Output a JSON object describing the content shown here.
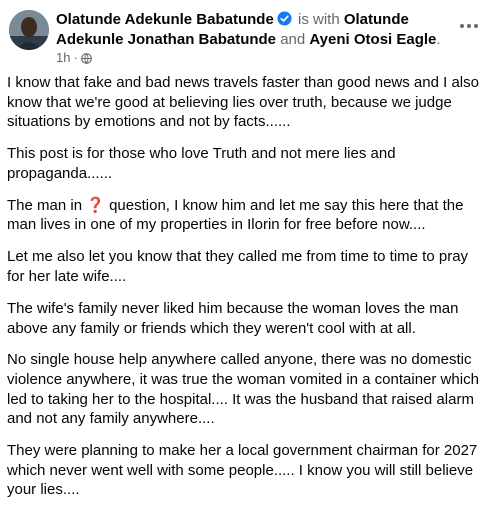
{
  "header": {
    "author": "Olatunde Adekunle Babatunde",
    "with_text": "is with",
    "tagged_1": "Olatunde Adekunle Jonathan Babatunde",
    "and_text": "and",
    "tagged_2": "Ayeni Otosi Eagle",
    "period": ".",
    "time": "1h",
    "dot": "·",
    "icons": {
      "verified": "verified-badge-icon",
      "privacy": "globe-icon",
      "menu": "more-options-icon"
    }
  },
  "post": {
    "p1": "I know that fake and bad news travels faster than good news and I also know that we're good at believing lies over truth, because we judge situations by emotions and not by facts......",
    "p2": "This post is for those who love Truth and not mere lies and propaganda......",
    "p3_before": "The man in ",
    "p3_emoji": "❓",
    "p3_after": " question, I know him and let me say this here that the man lives in one of my properties in Ilorin for free before now....",
    "p4": "Let me also let you know that they called me from time to time to pray for her late wife....",
    "p5": "The wife's family never liked him because the woman loves the man above any family or friends which they weren't cool with at all.",
    "p6": "No single house help anywhere called anyone, there was no domestic violence anywhere,  it was true the woman vomited in a container which led to taking her to the hospital.... It was the husband that raised alarm and not any family anywhere....",
    "p7": "They were planning to make her a local government chairman for 2027 which never went well with some people..... I know you will still believe your lies...."
  },
  "colors": {
    "verified": "#1877f2",
    "secondary_text": "#65676b",
    "question_mark": "#e02020"
  }
}
